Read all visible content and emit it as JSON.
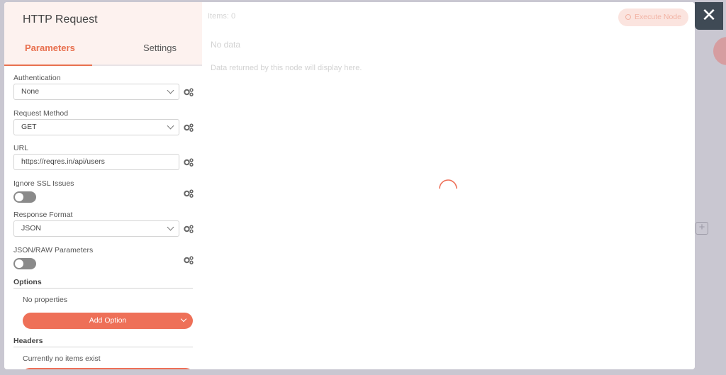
{
  "node": {
    "title": "HTTP Request",
    "tabs": [
      {
        "label": "Parameters",
        "active": true
      },
      {
        "label": "Settings",
        "active": false
      }
    ]
  },
  "parameters": {
    "authentication": {
      "label": "Authentication",
      "value": "None"
    },
    "request_method": {
      "label": "Request Method",
      "value": "GET"
    },
    "url": {
      "label": "URL",
      "value": "https://reqres.in/api/users"
    },
    "ignore_ssl": {
      "label": "Ignore SSL Issues",
      "enabled": false
    },
    "response_format": {
      "label": "Response Format",
      "value": "JSON"
    },
    "json_raw": {
      "label": "JSON/RAW Parameters",
      "enabled": false
    }
  },
  "options": {
    "title": "Options",
    "empty_text": "No properties",
    "add_label": "Add Option"
  },
  "headers": {
    "title": "Headers",
    "empty_text": "Currently no items exist"
  },
  "output": {
    "items_label": "Items: 0",
    "execute_label": "Execute Node",
    "no_data": "No data",
    "no_data_hint": "Data returned by this node will display here."
  },
  "colors": {
    "accent": "#ee7058",
    "header_bg": "#fdf2ef",
    "close_bg": "#3f4a55",
    "backdrop": "#c9c7d1"
  },
  "icons": {
    "close": "close-icon",
    "gear": "gears-icon",
    "chevron": "chevron-down-icon",
    "spinner": "loading-spinner",
    "plus": "plus-icon"
  }
}
